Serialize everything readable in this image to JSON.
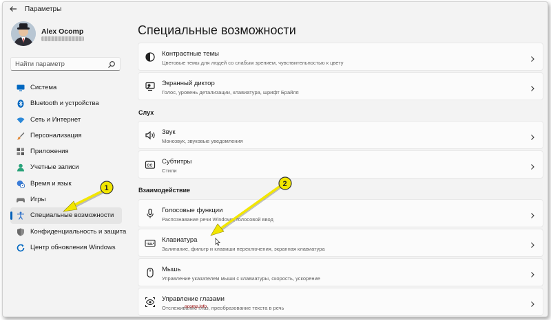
{
  "window": {
    "title": "Параметры"
  },
  "user": {
    "name": "Alex Ocomp"
  },
  "search": {
    "placeholder": "Найти параметр"
  },
  "sidebar": {
    "items": [
      {
        "label": "Система",
        "icon": "monitor-icon",
        "color": "#0067c0"
      },
      {
        "label": "Bluetooth и устройства",
        "icon": "bluetooth-icon",
        "color": "#0067c0"
      },
      {
        "label": "Сеть и Интернет",
        "icon": "wifi-icon",
        "color": "#2b88d8"
      },
      {
        "label": "Персонализация",
        "icon": "brush-icon",
        "color": "#e08a3c"
      },
      {
        "label": "Приложения",
        "icon": "apps-icon",
        "color": "#5a5a5a"
      },
      {
        "label": "Учетные записи",
        "icon": "person-icon",
        "color": "#2aa37a"
      },
      {
        "label": "Время и язык",
        "icon": "globe-clock-icon",
        "color": "#3b7dd8"
      },
      {
        "label": "Игры",
        "icon": "gamepad-icon",
        "color": "#777777"
      },
      {
        "label": "Специальные возможности",
        "icon": "accessibility-icon",
        "color": "#2b6fc9",
        "active": true
      },
      {
        "label": "Конфиденциальность и защита",
        "icon": "shield-icon",
        "color": "#7a7a7a"
      },
      {
        "label": "Центр обновления Windows",
        "icon": "update-icon",
        "color": "#0067c0"
      }
    ]
  },
  "main": {
    "title": "Специальные возможности",
    "sections": {
      "hearing": "Слух",
      "interaction": "Взаимодействие"
    },
    "cards": [
      {
        "title": "Контрастные темы",
        "subtitle": "Цветовые темы для людей со слабым зрением, чувствительностью к цвету",
        "icon": "contrast-icon"
      },
      {
        "title": "Экранный диктор",
        "subtitle": "Голос, уровень детализации, клавиатура, шрифт Брайля",
        "icon": "narrator-icon"
      },
      {
        "title": "Звук",
        "subtitle": "Монозвук, звуковые уведомления",
        "icon": "speaker-icon"
      },
      {
        "title": "Субтитры",
        "subtitle": "Стили",
        "icon": "captions-icon"
      },
      {
        "title": "Голосовые функции",
        "subtitle": "Распознавание речи Windows,  голосовой ввод",
        "icon": "microphone-icon"
      },
      {
        "title": "Клавиатура",
        "subtitle": "Залипание, фильтр и клавиши переключения, экранная клавиатура",
        "icon": "keyboard-icon"
      },
      {
        "title": "Мышь",
        "subtitle": "Управление указателем мыши с клавиатуры, скорость, ускорение",
        "icon": "mouse-icon"
      },
      {
        "title": "Управление глазами",
        "subtitle": "Отслеживание глаз, преобразование текста в речь",
        "icon": "eye-icon"
      }
    ]
  },
  "annotations": [
    {
      "label": "1",
      "color": "#f2e600"
    },
    {
      "label": "2",
      "color": "#f2e600"
    }
  ],
  "watermark": {
    "text": "ocomp.info"
  }
}
